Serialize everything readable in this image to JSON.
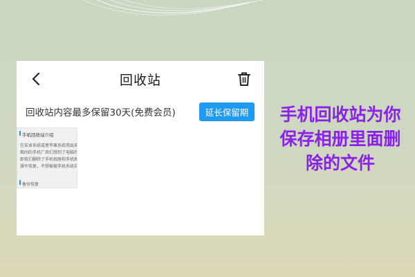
{
  "nav": {
    "title": "回收站",
    "back_icon": "chevron-left-icon",
    "trash_icon": "trash-icon"
  },
  "notice": {
    "text": "回收站内容最多保留30天(免费会员)"
  },
  "extend_button": {
    "label": "延长保留期"
  },
  "thumbnail": {
    "heading": "手机回收站介绍",
    "lines": [
      "在安卓系统或者苹果系统用出来的图",
      "期间的手机厂商们想到了电脑的回收",
      "即我们删除了手机相册和手机图片的",
      "操作恢复，不想被被手机系统自动删"
    ],
    "footer": "备份恢复"
  },
  "caption": {
    "lines": [
      "手机回收站为你",
      "保存相册里面删",
      "除的文件"
    ]
  },
  "colors": {
    "accent": "#1e9bf0",
    "caption": "#8a21e8"
  }
}
